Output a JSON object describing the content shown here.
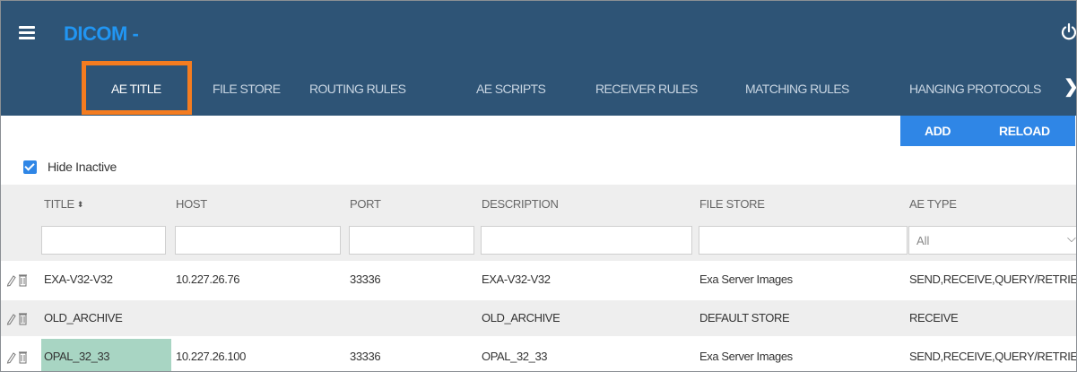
{
  "app": {
    "title": "DICOM -"
  },
  "tabs": [
    {
      "label": "AE TITLE",
      "active": true
    },
    {
      "label": "FILE STORE",
      "active": false
    },
    {
      "label": "ROUTING RULES",
      "active": false
    },
    {
      "label": "AE SCRIPTS",
      "active": false
    },
    {
      "label": "RECEIVER RULES",
      "active": false
    },
    {
      "label": "MATCHING RULES",
      "active": false
    },
    {
      "label": "HANGING PROTOCOLS",
      "active": false
    }
  ],
  "toolbar": {
    "add_label": "ADD",
    "reload_label": "RELOAD"
  },
  "filters": {
    "hide_inactive_label": "Hide Inactive",
    "hide_inactive_checked": true
  },
  "columns": [
    "TITLE",
    "HOST",
    "PORT",
    "DESCRIPTION",
    "FILE STORE",
    "AE TYPE"
  ],
  "ae_type_filter": {
    "selected": "All"
  },
  "rows": [
    {
      "title": "EXA-V32-V32",
      "host": "10.227.26.76",
      "port": "33336",
      "description": "EXA-V32-V32",
      "file_store": "Exa Server Images",
      "ae_type": "SEND,RECEIVE,QUERY/RETRIEVE"
    },
    {
      "title": "OLD_ARCHIVE",
      "host": "",
      "port": "",
      "description": "OLD_ARCHIVE",
      "file_store": "DEFAULT STORE",
      "ae_type": "RECEIVE"
    },
    {
      "title": "OPAL_32_33",
      "host": "10.227.26.100",
      "port": "33336",
      "description": "OPAL_32_33",
      "file_store": "Exa Server Images",
      "ae_type": "SEND,RECEIVE,QUERY/RETRIEVE"
    }
  ],
  "colors": {
    "header_bg": "#2e5476",
    "accent": "#2f86e6",
    "highlight_box": "#f47c20",
    "selected_cell": "#a8d5c3"
  },
  "icons": [
    "menu-icon",
    "power-icon",
    "chevron-right-icon",
    "checkbox-checked-icon",
    "sort-icon",
    "chevron-down-icon",
    "edit-pencil-icon",
    "delete-trash-icon"
  ]
}
